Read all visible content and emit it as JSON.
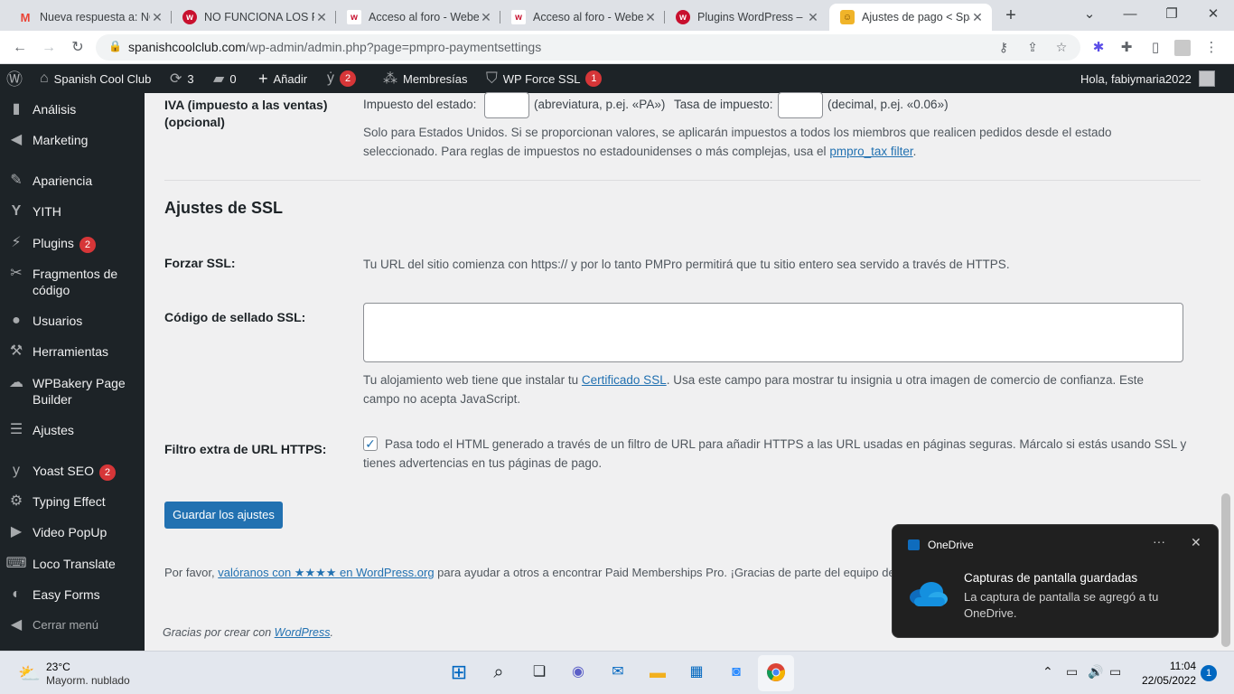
{
  "browser": {
    "tabs": [
      {
        "title": "Nueva respuesta a: NO",
        "favicon": "gmail-icon",
        "color": "#ea4335",
        "glyph": "M"
      },
      {
        "title": "NO FUNCIONA LOS PA",
        "favicon": "webempresa-icon",
        "color": "#c8102e",
        "glyph": "w"
      },
      {
        "title": "Acceso al foro - Webe",
        "favicon": "webempresa-icon",
        "color": "#c8102e",
        "glyph": "w"
      },
      {
        "title": "Acceso al foro - Webe",
        "favicon": "webempresa-icon",
        "color": "#c8102e",
        "glyph": "w"
      },
      {
        "title": "Plugins WordPress – F",
        "favicon": "webempresa-icon",
        "color": "#c8102e",
        "glyph": "w"
      },
      {
        "title": "Ajustes de pago < Spa",
        "favicon": "pmpro-icon",
        "color": "#f0b429",
        "glyph": "☺"
      }
    ],
    "url_host": "spanishcoolclub.com",
    "url_path": "/wp-admin/admin.php?page=pmpro-paymentsettings"
  },
  "adminbar": {
    "site_name": "Spanish Cool Club",
    "updates_count": "3",
    "comments_count": "0",
    "new_label": "Añadir",
    "yoast_count": "2",
    "memberships_label": "Membresías",
    "ssl_label": "WP Force SSL",
    "ssl_count": "1",
    "greeting": "Hola, fabiymaria2022"
  },
  "sidebar": {
    "items": [
      {
        "label": "Análisis",
        "icon": "bar-chart-icon",
        "glyph": "▮"
      },
      {
        "label": "Marketing",
        "icon": "megaphone-icon",
        "glyph": "◀"
      },
      {
        "label": "Apariencia",
        "icon": "paintbrush-icon",
        "glyph": "✎"
      },
      {
        "label": "YITH",
        "icon": "yith-icon",
        "glyph": "Y"
      },
      {
        "label": "Plugins",
        "icon": "plug-icon",
        "glyph": "⚡",
        "badge": "2"
      },
      {
        "label": "Fragmentos de código",
        "icon": "scissors-icon",
        "glyph": "✂"
      },
      {
        "label": "Usuarios",
        "icon": "user-icon",
        "glyph": "●"
      },
      {
        "label": "Herramientas",
        "icon": "wrench-icon",
        "glyph": "⚒"
      },
      {
        "label": "WPBakery Page Builder",
        "icon": "cloud-icon",
        "glyph": "☁"
      },
      {
        "label": "Ajustes",
        "icon": "settings-sliders-icon",
        "glyph": "☰"
      },
      {
        "label": "Yoast SEO",
        "icon": "yoast-icon",
        "glyph": "y",
        "badge": "2"
      },
      {
        "label": "Typing Effect",
        "icon": "gear-icon",
        "glyph": "⚙"
      },
      {
        "label": "Video PopUp",
        "icon": "video-icon",
        "glyph": "▶"
      },
      {
        "label": "Loco Translate",
        "icon": "translate-icon",
        "glyph": "⌨"
      },
      {
        "label": "Easy Forms",
        "icon": "forms-icon",
        "glyph": "◐"
      },
      {
        "label": "Cerrar menú",
        "icon": "collapse-icon",
        "glyph": "◀"
      }
    ]
  },
  "tax": {
    "label": "IVA (impuesto a las ventas) (opcional)",
    "state_label": "Impuesto del estado:",
    "state_hint": "(abreviatura, p.ej. «PA»)",
    "rate_label": "Tasa de impuesto:",
    "rate_hint": "(decimal, p.ej. «0.06»)",
    "desc_prefix": "Solo para Estados Unidos. Si se proporcionan valores, se aplicarán impuestos a todos los miembros que realicen pedidos desde el estado seleccionado. Para reglas de impuestos no estadounidenses o más complejas, usa el ",
    "desc_link": "pmpro_tax filter",
    "desc_suffix": "."
  },
  "ssl": {
    "heading": "Ajustes de SSL",
    "force_label": "Forzar SSL:",
    "force_desc": "Tu URL del sitio comienza con https:// y por lo tanto PMPro permitirá que tu sitio entero sea servido a través de HTTPS.",
    "seal_label": "Código de sellado SSL:",
    "seal_value": "",
    "seal_desc_prefix": "Tu alojamiento web tiene que instalar tu ",
    "seal_desc_link": "Certificado SSL",
    "seal_desc_suffix": ". Usa este campo para mostrar tu insignia u otra imagen de comercio de confianza. Este campo no acepta JavaScript.",
    "filter_label": "Filtro extra de URL HTTPS:",
    "filter_checked": true,
    "filter_desc": "Pasa todo el HTML generado a través de un filtro de URL para añadir HTTPS a las URL usadas en páginas seguras. Márcalo si estás usando SSL y tienes advertencias en tus páginas de pago."
  },
  "save_button": "Guardar los ajustes",
  "footer": {
    "rate_prefix": "Por favor, ",
    "rate_link": "valóranos con ★★★★ en WordPress.org",
    "rate_suffix": " para ayudar a otros a encontrar Paid Memberships Pro. ¡Gracias de parte del equipo de P",
    "thanks_prefix": "Gracias por crear con ",
    "thanks_link": "WordPress",
    "thanks_suffix": "."
  },
  "toast": {
    "app": "OneDrive",
    "title": "Capturas de pantalla guardadas",
    "body": "La captura de pantalla se agregó a tu OneDrive."
  },
  "taskbar": {
    "temp": "23°C",
    "weather": "Mayorm. nublado",
    "time": "11:04",
    "date": "22/05/2022",
    "notifications": "1"
  },
  "colors": {
    "wp_dark": "#1d2327",
    "wp_blue": "#2271b1",
    "badge_red": "#d63638"
  }
}
